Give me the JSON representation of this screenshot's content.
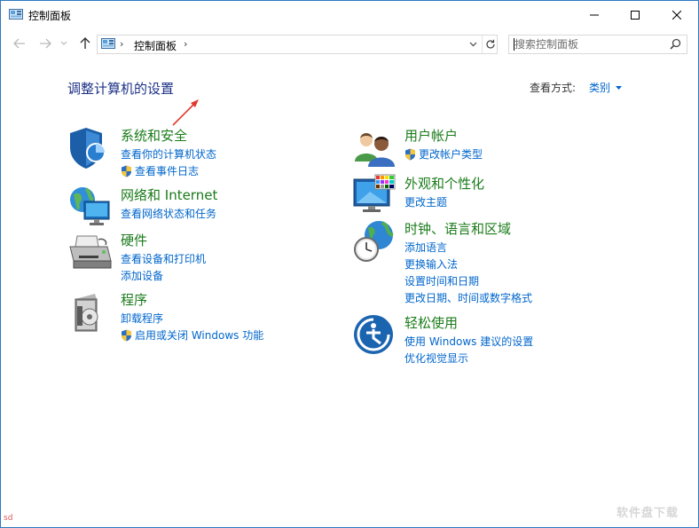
{
  "window": {
    "title": "控制面板",
    "accent": "#2b79c2"
  },
  "nav": {
    "breadcrumb": "控制面板",
    "search_placeholder": "搜索控制面板"
  },
  "main": {
    "heading": "调整计算机的设置",
    "view_by_label": "查看方式:",
    "view_by_value": "类别"
  },
  "categories": {
    "system": {
      "title": "系统和安全",
      "links": [
        "查看你的计算机状态",
        "查看事件日志"
      ]
    },
    "network": {
      "title": "网络和 Internet",
      "links": [
        "查看网络状态和任务"
      ]
    },
    "hardware": {
      "title": "硬件",
      "links": [
        "查看设备和打印机",
        "添加设备"
      ]
    },
    "programs": {
      "title": "程序",
      "links": [
        "卸载程序",
        "启用或关闭 Windows 功能"
      ]
    },
    "users": {
      "title": "用户帐户",
      "links": [
        "更改帐户类型"
      ]
    },
    "appearance": {
      "title": "外观和个性化",
      "links": [
        "更改主题"
      ]
    },
    "clock": {
      "title": "时钟、语言和区域",
      "links": [
        "添加语言",
        "更换输入法",
        "设置时间和日期",
        "更改日期、时间或数字格式"
      ]
    },
    "ease": {
      "title": "轻松使用",
      "links": [
        "使用 Windows 建议的设置",
        "优化视觉显示"
      ]
    }
  },
  "colors": {
    "link": "#0066cc",
    "category_title": "#1a7b1a",
    "heading": "#1e3287"
  },
  "overlay": {
    "corner_mark": "sd",
    "watermark": "软件盘下载"
  }
}
